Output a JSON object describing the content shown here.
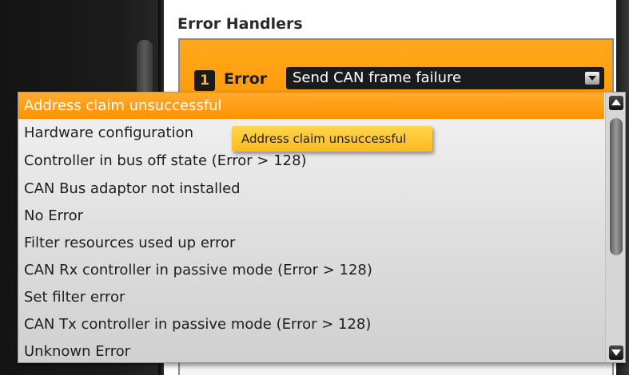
{
  "section": {
    "heading": "Error Handlers"
  },
  "handler": {
    "index": "1",
    "error_label": "Error",
    "selected_value": "Send CAN frame failure"
  },
  "dropdown": {
    "options": [
      "Address claim unsuccessful",
      "Hardware configuration",
      "Controller in bus off state (Error > 128)",
      "CAN Bus adaptor not installed",
      "No Error",
      "Filter resources used up error",
      "CAN Rx controller in passive mode (Error > 128)",
      "Set filter error",
      "CAN Tx controller in passive mode (Error > 128)",
      "Unknown Error"
    ],
    "highlighted_index": 0
  },
  "tooltip": {
    "text": "Address claim unsuccessful"
  },
  "colors": {
    "accent": "#ff9a05",
    "dark": "#1b1b1b",
    "tooltip": "#ffc531"
  },
  "icons": {
    "combo_arrow": "chevron-down-icon",
    "scroll_up": "arrow-up-icon",
    "scroll_down": "arrow-down-icon"
  }
}
